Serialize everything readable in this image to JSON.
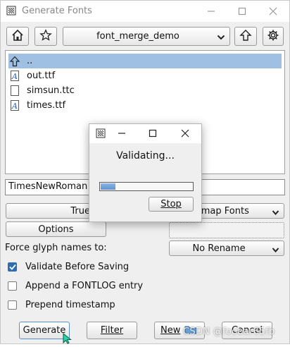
{
  "window": {
    "title": "Generate Fonts"
  },
  "toolbar": {
    "home_icon": "home-icon",
    "bookmark_icon": "star-icon",
    "directory": "font_merge_demo",
    "up_icon": "up-arrow-icon",
    "settings_icon": "gear-icon"
  },
  "files": [
    {
      "name": "..",
      "icon": "up-folder-icon",
      "selected": true
    },
    {
      "name": "out.ttf",
      "icon": "font-file-icon",
      "selected": false
    },
    {
      "name": "simsun.ttc",
      "icon": "file-icon",
      "selected": false
    },
    {
      "name": "times.ttf",
      "icon": "font-file-icon",
      "selected": false
    }
  ],
  "filename_field": {
    "value": "TimesNewRoman"
  },
  "format": {
    "outline_label": "TrueTy",
    "bitmap_label": "Bitmap Fonts"
  },
  "options_label": "Options",
  "glyph_names": {
    "label": "Force glyph names to:",
    "value": "No Rename"
  },
  "checkboxes": [
    {
      "label": "Validate Before Saving",
      "checked": true
    },
    {
      "label": "Append a FONTLOG entry",
      "checked": false
    },
    {
      "label": "Prepend timestamp",
      "checked": false
    }
  ],
  "buttons": {
    "generate": "Generate",
    "filter": "Filter",
    "new": "New",
    "cancel": "Cancel"
  },
  "watermark": "CSDN @foobar65fb",
  "dialog": {
    "message": "Validating...",
    "progress_fraction": 0.16,
    "stop_label": "Stop"
  },
  "colors": {
    "selection": "#9fc0e3",
    "progress": "#6b9bd3",
    "checkbox_checked": "#2f6db3"
  }
}
